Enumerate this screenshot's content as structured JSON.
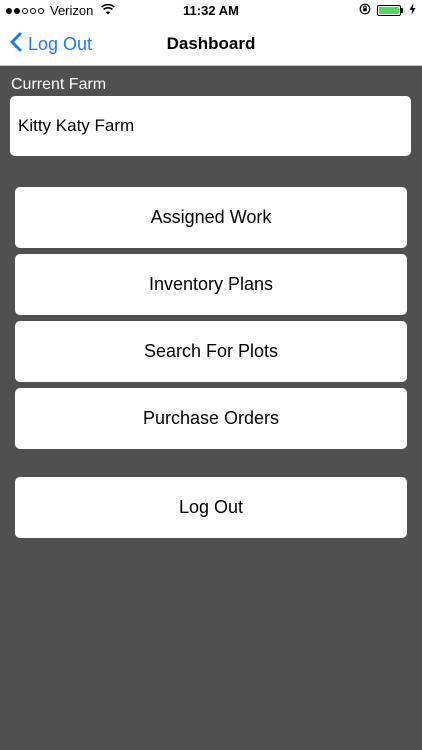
{
  "status_bar": {
    "carrier": "Verizon",
    "time": "11:32 AM",
    "icons": [
      "signal-dots-icon",
      "wifi-icon",
      "rotation-lock-icon",
      "battery-icon",
      "charging-bolt-icon"
    ],
    "battery_color": "#4cd964"
  },
  "nav": {
    "back_label": "Log Out",
    "title": "Dashboard",
    "accent_color": "#1a7cf6"
  },
  "farm": {
    "label": "Current Farm",
    "value": "Kitty Katy Farm"
  },
  "menu": {
    "assigned_work": "Assigned Work",
    "inventory_plans": "Inventory Plans",
    "search_plots": "Search For Plots",
    "purchase_orders": "Purchase Orders",
    "log_out": "Log Out"
  },
  "colors": {
    "background": "#505050",
    "surface": "#ffffff"
  }
}
